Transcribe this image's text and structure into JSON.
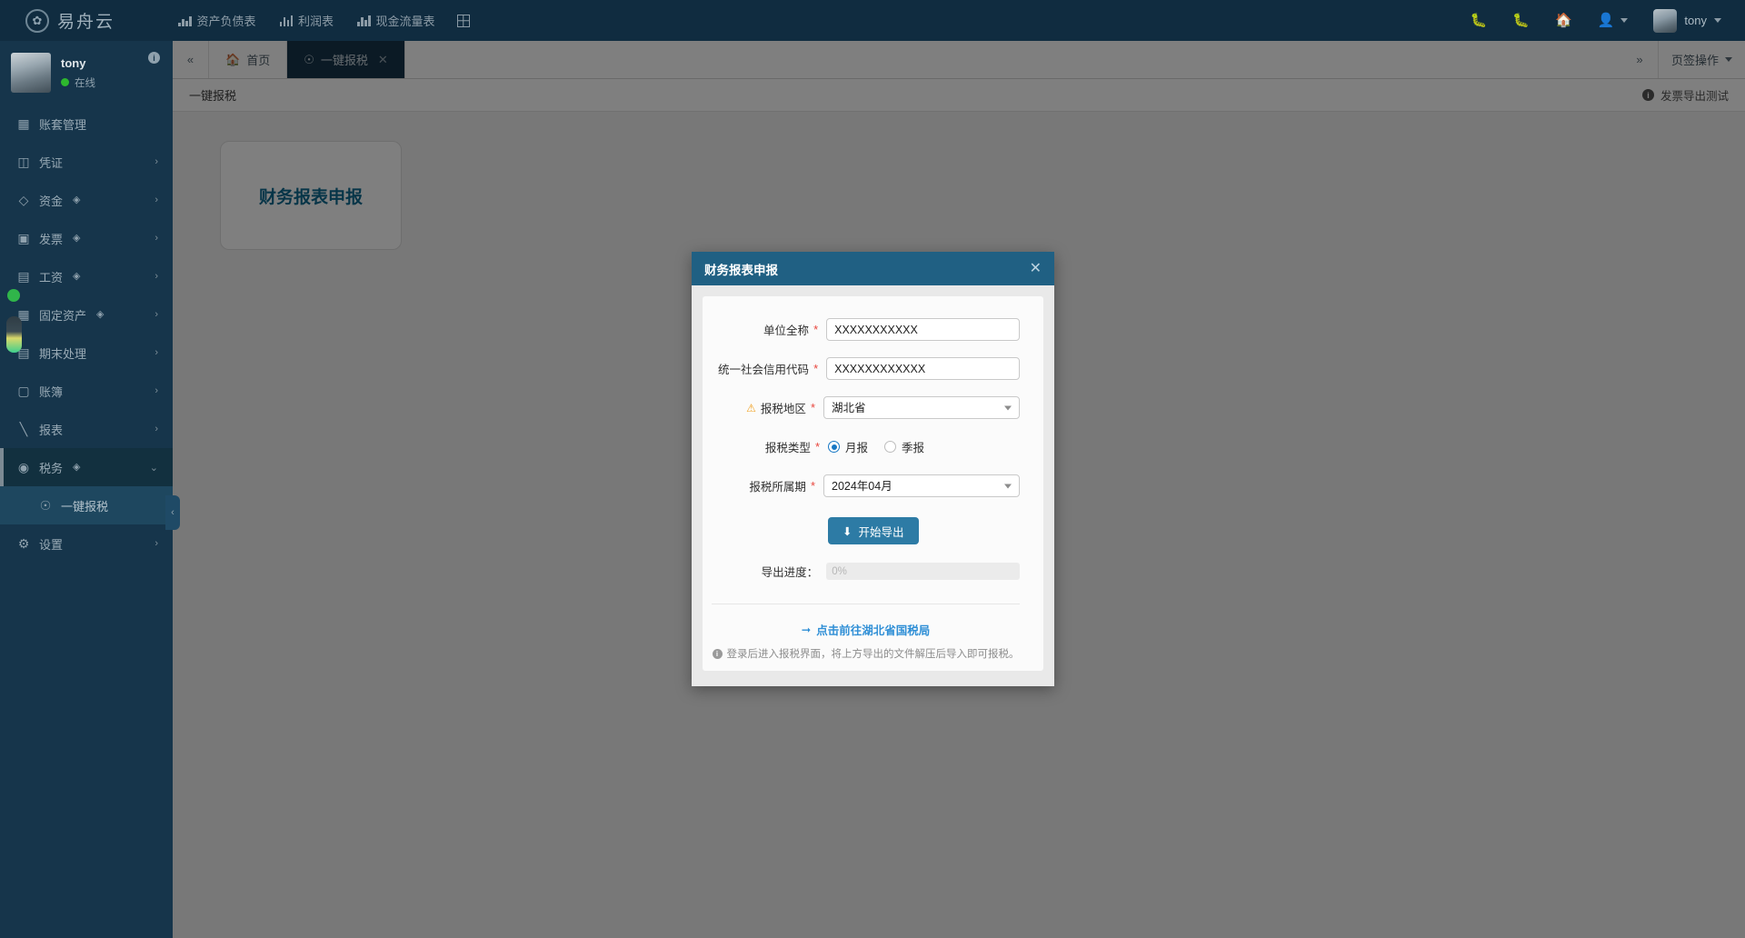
{
  "header": {
    "brand_name": "易舟云",
    "nav": [
      {
        "label": "资产负债表",
        "icon": "chart-area-icon"
      },
      {
        "label": "利润表",
        "icon": "bar-chart-icon"
      },
      {
        "label": "现金流量表",
        "icon": "bar-chart-icon"
      }
    ],
    "grid_icon": "grid-icon",
    "right_icons": [
      "bug-icon",
      "bug-icon",
      "home-icon",
      "user-switch-icon"
    ],
    "username": "tony"
  },
  "sidebar": {
    "profile": {
      "name": "tony",
      "status": "在线",
      "badge": "i"
    },
    "items": [
      {
        "label": "账套管理",
        "icon": "book-icon",
        "arrow": false,
        "gem": false
      },
      {
        "label": "凭证",
        "icon": "voucher-icon",
        "arrow": true,
        "gem": false
      },
      {
        "label": "资金",
        "icon": "funds-icon",
        "arrow": true,
        "gem": true
      },
      {
        "label": "发票",
        "icon": "invoice-icon",
        "arrow": true,
        "gem": true
      },
      {
        "label": "工资",
        "icon": "card-icon",
        "arrow": true,
        "gem": true
      },
      {
        "label": "固定资产",
        "icon": "building-icon",
        "arrow": true,
        "gem": true
      },
      {
        "label": "期末处理",
        "icon": "calendar-icon",
        "arrow": true,
        "gem": false
      },
      {
        "label": "账簿",
        "icon": "ledger-icon",
        "arrow": true,
        "gem": false
      },
      {
        "label": "报表",
        "icon": "report-icon",
        "arrow": true,
        "gem": false
      },
      {
        "label": "税务",
        "icon": "tax-icon",
        "arrow": true,
        "gem": true,
        "active": true,
        "expanded": true
      },
      {
        "label": "设置",
        "icon": "gear-icon",
        "arrow": true,
        "gem": false
      }
    ],
    "subitem": {
      "label": "一键报税",
      "icon": "tax-sub-icon"
    },
    "collapse_handle": "‹"
  },
  "tabbar": {
    "prev_icon": "double-chevron-left-icon",
    "tabs": [
      {
        "label": "首页",
        "icon": "home-icon",
        "active": false,
        "closable": false
      },
      {
        "label": "一键报税",
        "icon": "tax-sub-icon",
        "active": true,
        "closable": true
      }
    ],
    "next_icon": "double-chevron-right-icon",
    "actions_label": "页签操作"
  },
  "pagehead": {
    "title": "一键报税",
    "right_label": "发票导出测试",
    "right_badge": "i"
  },
  "content": {
    "cards": [
      {
        "title": "财务报表申报"
      }
    ]
  },
  "modal": {
    "title": "财务报表申报",
    "close": "✕",
    "fields": {
      "company_name_label": "单位全称",
      "company_name_value": "XXXXXXXXXXX",
      "credit_code_label": "统一社会信用代码",
      "credit_code_value": "XXXXXXXXXXXX",
      "region_label": "报税地区",
      "region_value": "湖北省",
      "type_label": "报税类型",
      "type_options": [
        {
          "label": "月报",
          "selected": true
        },
        {
          "label": "季报",
          "selected": false
        }
      ],
      "period_label": "报税所属期",
      "period_value": "2024年04月"
    },
    "export_button": "开始导出",
    "export_icon": "download-icon",
    "progress_label": "导出进度：",
    "progress_value": "0%",
    "footer_link": "点击前往湖北省国税局",
    "footer_link_icon": "arrow-right-icon",
    "footer_note": "登录后进入报税界面，将上方导出的文件解压后导入即可报税。",
    "footer_note_badge": "i"
  },
  "colors": {
    "header_bg": "#102c40",
    "sidebar_bg": "#16354b",
    "modal_header": "#206083",
    "accent": "#2d7ba5",
    "card_title": "#0e6a91",
    "link": "#2f8fd6",
    "required": "#e8453c",
    "warning": "#f0a020",
    "online": "#2eb82e"
  }
}
